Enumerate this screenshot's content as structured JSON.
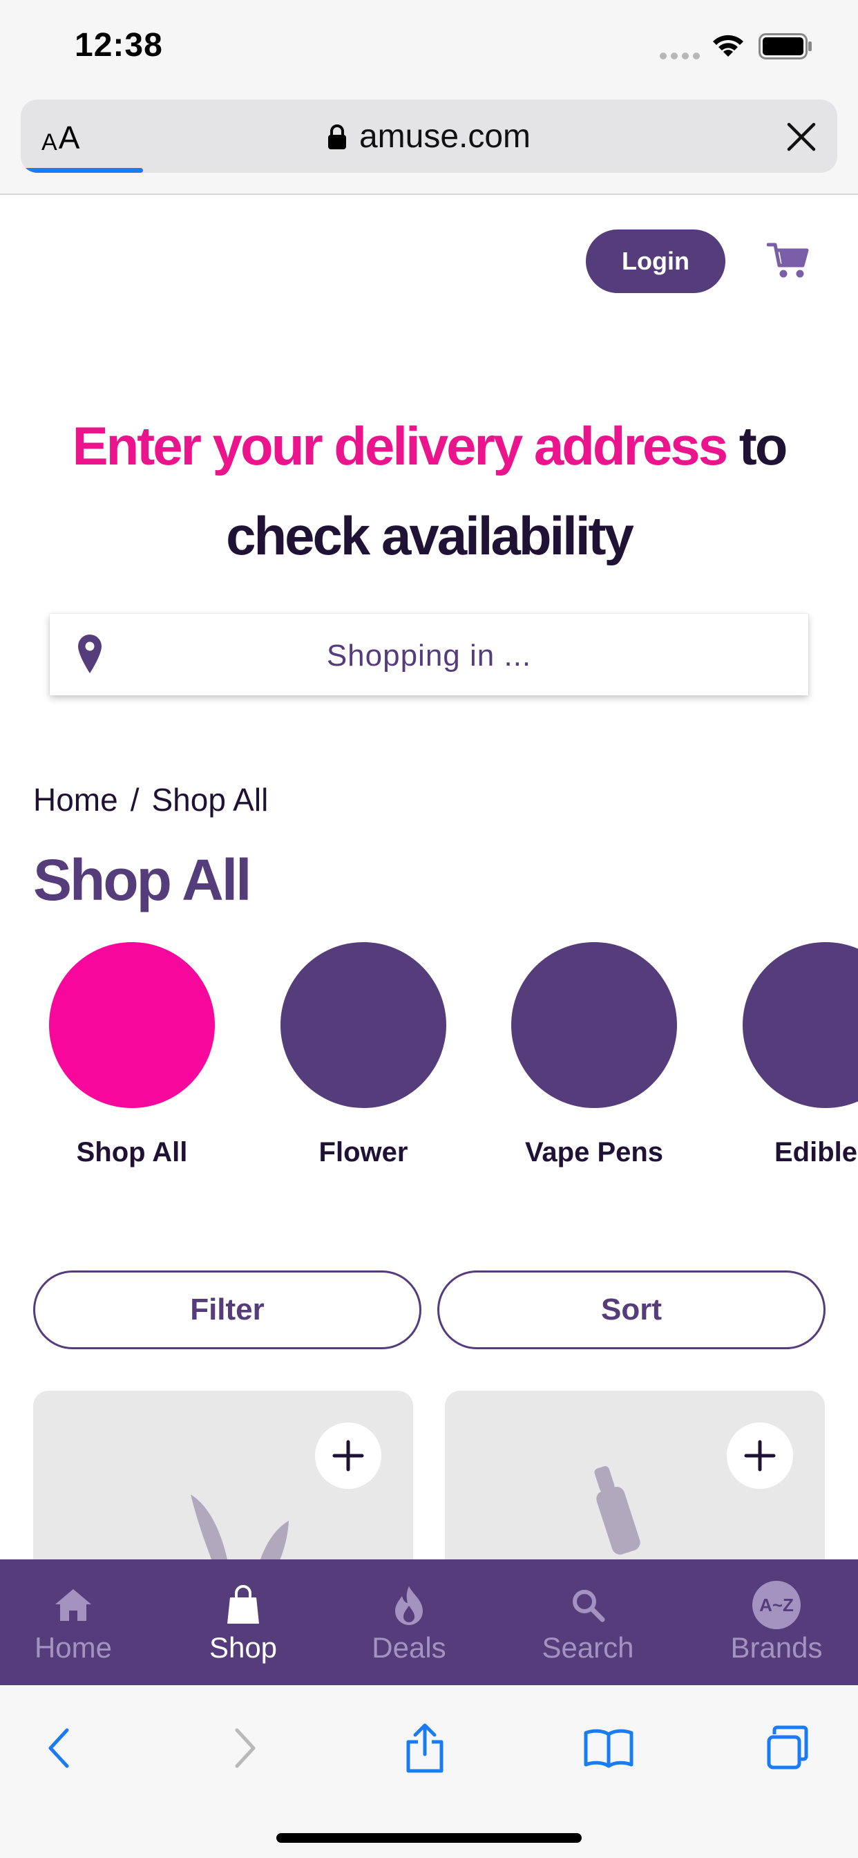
{
  "status_bar": {
    "time": "12:38"
  },
  "browser": {
    "reader_small": "A",
    "reader_big": "A",
    "url": "amuse.com",
    "load_progress": 0.15
  },
  "header": {
    "login_label": "Login"
  },
  "hero": {
    "title_accent": "Enter your delivery address",
    "title_rest_1": " to",
    "title_rest_2": "check availability"
  },
  "address": {
    "placeholder": "Shopping in ..."
  },
  "breadcrumb": {
    "home": "Home",
    "separator": "/",
    "current": "Shop All"
  },
  "page_title": "Shop All",
  "categories": [
    {
      "label": "Shop All",
      "active": true
    },
    {
      "label": "Flower",
      "active": false
    },
    {
      "label": "Vape Pens",
      "active": false
    },
    {
      "label": "Edibles",
      "active": false
    }
  ],
  "controls": {
    "filter_label": "Filter",
    "sort_label": "Sort"
  },
  "tabs": [
    {
      "label": "Home",
      "icon": "home-icon"
    },
    {
      "label": "Shop",
      "icon": "shopping-bag-icon",
      "active": true
    },
    {
      "label": "Deals",
      "icon": "flame-icon"
    },
    {
      "label": "Search",
      "icon": "search-icon"
    },
    {
      "label": "Brands",
      "icon": "brands-badge-icon",
      "badge_text": "A~Z"
    }
  ],
  "colors": {
    "brand_purple": "#553c7b",
    "brand_pink": "#ec148c",
    "active_category": "#f7079b",
    "tab_inactive": "#a493c0",
    "safari_blue": "#1a7cf5"
  }
}
